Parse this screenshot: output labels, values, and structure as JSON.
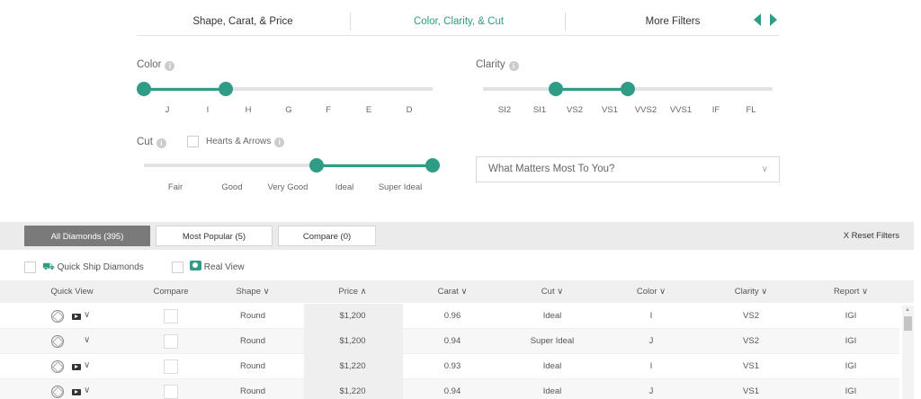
{
  "tabs": [
    {
      "label": "Shape, Carat, & Price"
    },
    {
      "label": "Color, Clarity, & Cut"
    },
    {
      "label": "More Filters"
    }
  ],
  "filters": {
    "color": {
      "label": "Color",
      "scale": [
        "J",
        "I",
        "H",
        "G",
        "F",
        "E",
        "D"
      ],
      "selected_range": [
        "J",
        "H"
      ]
    },
    "clarity": {
      "label": "Clarity",
      "scale": [
        "SI2",
        "SI1",
        "VS2",
        "VS1",
        "VVS2",
        "VVS1",
        "IF",
        "FL"
      ],
      "selected_range": [
        "SI1",
        "VS1"
      ]
    },
    "cut": {
      "label": "Cut",
      "scale": [
        "Fair",
        "Good",
        "Very Good",
        "Ideal",
        "Super Ideal"
      ],
      "selected_range": [
        "Ideal",
        "Super Ideal"
      ]
    },
    "hearts_label": "Hearts & Arrows",
    "matters_placeholder": "What Matters Most To You?"
  },
  "results": {
    "tabs": [
      {
        "label": "All Diamonds (395)"
      },
      {
        "label": "Most Popular (5)"
      },
      {
        "label": "Compare (0)"
      }
    ],
    "reset": "X Reset Filters",
    "quick_ship": "Quick Ship Diamonds",
    "real_view": "Real View"
  },
  "table": {
    "headers": [
      "Quick View",
      "Compare",
      "Shape ∨",
      "Price ∧",
      "Carat ∨",
      "Cut ∨",
      "Color ∨",
      "Clarity ∨",
      "Report ∨"
    ],
    "rows": [
      {
        "shape": "Round",
        "price": "$1,200",
        "carat": "0.96",
        "cut": "Ideal",
        "color": "I",
        "clarity": "VS2",
        "report": "IGI",
        "video": true
      },
      {
        "shape": "Round",
        "price": "$1,200",
        "carat": "0.94",
        "cut": "Super Ideal",
        "color": "J",
        "clarity": "VS2",
        "report": "IGI",
        "video": false
      },
      {
        "shape": "Round",
        "price": "$1,220",
        "carat": "0.93",
        "cut": "Ideal",
        "color": "I",
        "clarity": "VS1",
        "report": "IGI",
        "video": true
      },
      {
        "shape": "Round",
        "price": "$1,220",
        "carat": "0.94",
        "cut": "Ideal",
        "color": "J",
        "clarity": "VS1",
        "report": "IGI",
        "video": true
      }
    ]
  },
  "colors": {
    "accent": "#2f9c86",
    "active_tab_bg": "#7a7a7a"
  }
}
